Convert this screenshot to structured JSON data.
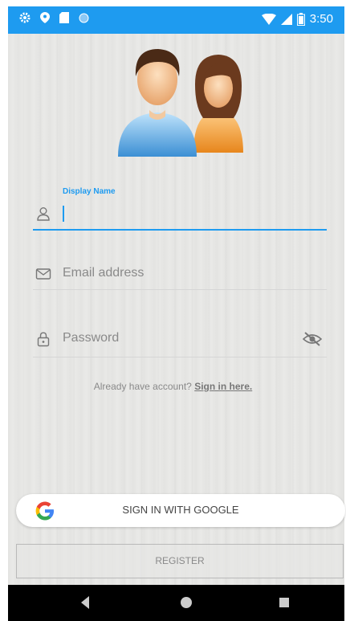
{
  "status_bar": {
    "time": "3:50"
  },
  "form": {
    "display_name_label": "Display Name",
    "display_name_value": "",
    "email_placeholder": "Email address",
    "password_placeholder": "Password"
  },
  "signin_prompt": {
    "text": "Already have account?",
    "link": "Sign in here."
  },
  "buttons": {
    "google": "SIGN IN WITH GOOGLE",
    "register": "REGISTER"
  },
  "colors": {
    "accent": "#1e9bf0",
    "background": "#e8e8e6",
    "navbar": "#000000"
  },
  "icons": {
    "status_left": [
      "settings-icon",
      "location-icon",
      "sd-card-icon",
      "sync-icon"
    ],
    "status_right": [
      "wifi-icon",
      "signal-icon",
      "battery-icon"
    ],
    "fields": [
      "user-icon",
      "mail-icon",
      "lock-icon",
      "eye-off-icon"
    ],
    "nav": [
      "back-icon",
      "home-icon",
      "recents-icon"
    ]
  }
}
